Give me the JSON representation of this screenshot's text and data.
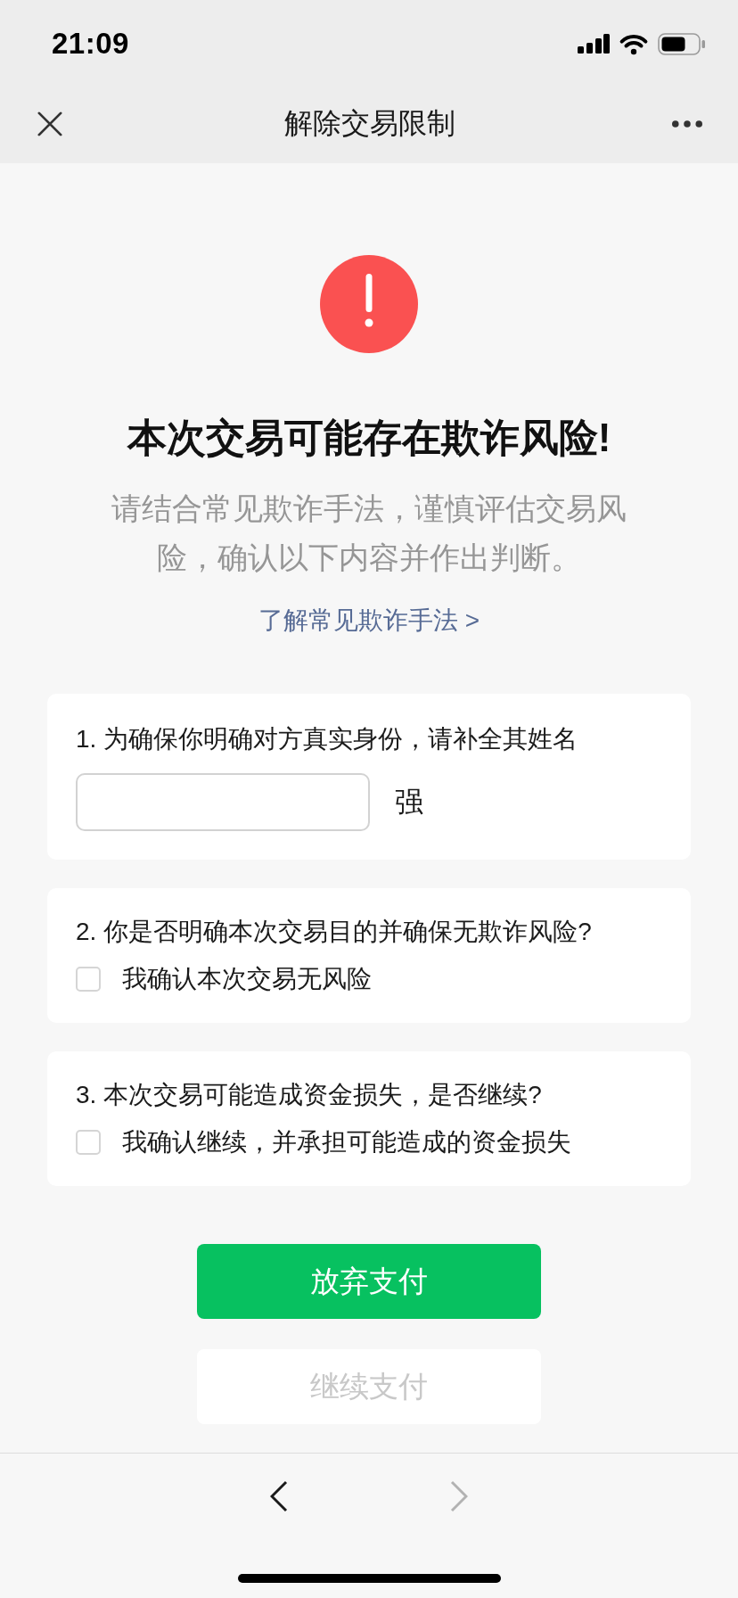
{
  "status_bar": {
    "time": "21:09"
  },
  "nav_bar": {
    "title": "解除交易限制"
  },
  "alert": {
    "title": "本次交易可能存在欺诈风险!",
    "description": "请结合常见欺诈手法，谨慎评估交易风险，确认以下内容并作出判断。",
    "link": "了解常见欺诈手法 >"
  },
  "questions": [
    {
      "kind": "name",
      "label": "1. 为确保你明确对方真实身份，请补全其姓名",
      "suffix": "强"
    },
    {
      "kind": "checkbox",
      "label": "2. 你是否明确本次交易目的并确保无欺诈风险?",
      "option": {
        "label": "我确认本次交易无风险",
        "checked": false
      }
    },
    {
      "kind": "checkbox",
      "label": "3. 本次交易可能造成资金损失，是否继续?",
      "option": {
        "label": "我确认继续，并承担可能造成的资金损失",
        "checked": false
      }
    }
  ],
  "buttons": [
    {
      "label": "放弃支付",
      "kind": "primary",
      "disabled": false
    },
    {
      "label": "继续支付",
      "kind": "secondary",
      "disabled": true
    }
  ],
  "toolbar": {
    "back": {
      "disabled": false
    },
    "forward": {
      "disabled": true
    }
  }
}
